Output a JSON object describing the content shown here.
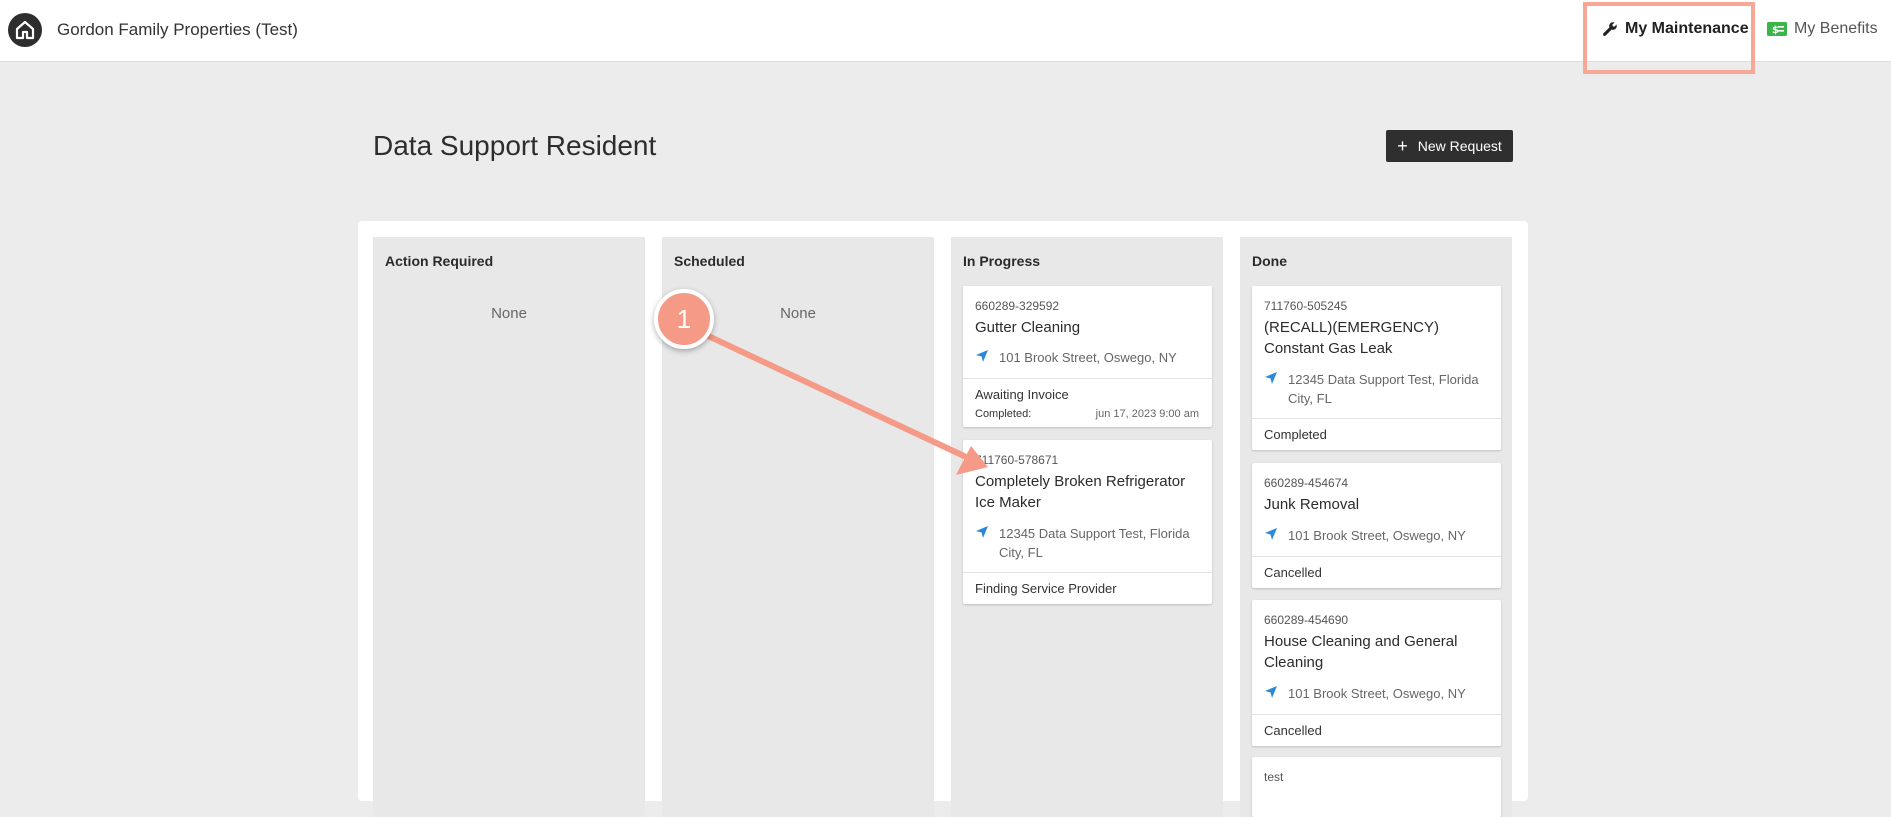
{
  "header": {
    "company_name": "Gordon Family Properties (Test)",
    "nav": {
      "maintenance_label": "My Maintenance",
      "benefits_label": "My Benefits"
    }
  },
  "page": {
    "title": "Data Support Resident",
    "new_request_label": "New Request"
  },
  "columns": {
    "action_required": {
      "title": "Action Required",
      "empty_text": "None"
    },
    "scheduled": {
      "title": "Scheduled",
      "empty_text": "None"
    },
    "in_progress": {
      "title": "In Progress",
      "cards": [
        {
          "id": "660289-329592",
          "title": "Gutter Cleaning",
          "address": "101 Brook Street, Oswego, NY",
          "status": "Awaiting Invoice",
          "completed_label": "Completed:",
          "completed_value": "jun 17, 2023 9:00 am"
        },
        {
          "id": "711760-578671",
          "title": "Completely Broken Refrigerator Ice Maker",
          "address": "12345 Data Support Test, Florida City, FL",
          "status": "Finding Service Provider"
        }
      ]
    },
    "done": {
      "title": "Done",
      "cards": [
        {
          "id": "711760-505245",
          "title": "(RECALL)(EMERGENCY) Constant Gas Leak",
          "address": "12345 Data Support Test, Florida City, FL",
          "status": "Completed"
        },
        {
          "id": "660289-454674",
          "title": "Junk Removal",
          "address": "101 Brook Street, Oswego, NY",
          "status": "Cancelled"
        },
        {
          "id": "660289-454690",
          "title": "House Cleaning and General Cleaning",
          "address": "101 Brook Street, Oswego, NY",
          "status": "Cancelled"
        },
        {
          "id": "test"
        }
      ]
    }
  },
  "annotation": {
    "step_number": "1"
  },
  "colors": {
    "accent_arrow": "#f59a87",
    "location_icon": "#2a8ad8",
    "benefits_icon": "#3bb54a",
    "button_bg": "#2f2f2f"
  },
  "icons": {
    "logo": "home-logo-icon",
    "maintenance": "wrench-icon",
    "benefits": "money-icon",
    "location": "navigation-arrow-icon",
    "new_request": "plus-icon"
  }
}
